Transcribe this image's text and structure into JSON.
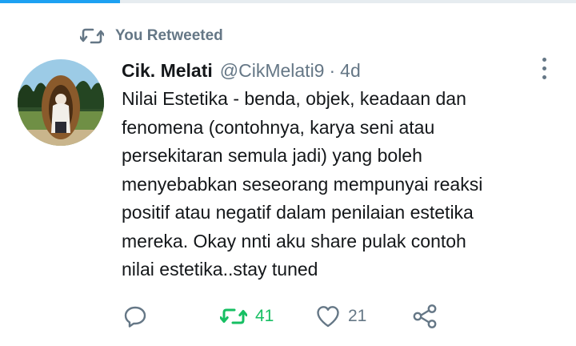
{
  "retweet_notice": {
    "text": "You Retweeted"
  },
  "author": {
    "name": "Cik. Melati",
    "handle": "@CikMelati9",
    "separator": "·",
    "time": "4d"
  },
  "tweet": {
    "lines": [
      "Nilai Estetika - benda, objek, keadaan dan",
      "fenomena (contohnya, karya seni atau",
      "persekitaran semula jadi) yang boleh",
      "menyebabkan seseorang mempunyai reaksi",
      "positif atau negatif dalam penilaian estetika",
      "mereka. Okay nnti aku share pulak contoh",
      "nilai estetika..stay tuned"
    ]
  },
  "actions": {
    "retweet_count": "41",
    "like_count": "21"
  },
  "colors": {
    "accent": "#1da1f2",
    "retweet_active": "#17bf63",
    "muted": "#657786",
    "text": "#14171a"
  },
  "icons": {
    "retweet": "retweet-icon",
    "reply": "reply-icon",
    "like": "heart-icon",
    "share": "share-icon",
    "more": "more-vertical-icon"
  }
}
